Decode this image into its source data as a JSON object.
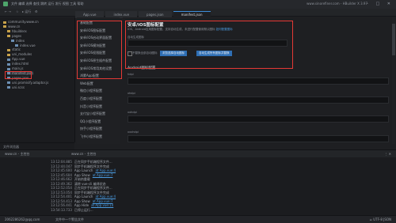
{
  "window": {
    "title": "www.sinorefiner.com - HBuilder X 3.97",
    "menu": "文件  编辑  选择  查找  跳转  运行  发行  视图  工具  帮助"
  },
  "toolbar": {
    "items": [
      "← →",
      "☆",
      "▸ 运行",
      "⚙"
    ]
  },
  "tabs": [
    {
      "label": "App.vue"
    },
    {
      "label": "index.vue"
    },
    {
      "label": "pages.json"
    },
    {
      "label": "manifest.json",
      "active": true
    }
  ],
  "tree": [
    {
      "label": "community.www.cn",
      "indent": 0
    },
    {
      "label": "www.cn",
      "indent": 0
    },
    {
      "label": "hbuilderx",
      "indent": 1
    },
    {
      "label": "pages",
      "indent": 1
    },
    {
      "label": "index",
      "indent": 2
    },
    {
      "label": "index.vue",
      "indent": 3
    },
    {
      "label": "static",
      "indent": 1
    },
    {
      "label": "uni_modules",
      "indent": 1
    },
    {
      "label": "App.vue",
      "indent": 1
    },
    {
      "label": "index.html",
      "indent": 1
    },
    {
      "label": "main.js",
      "indent": 1
    },
    {
      "label": "manifest.json",
      "indent": 1,
      "selected": true
    },
    {
      "label": "pages.json",
      "indent": 1
    },
    {
      "label": "uni.promisify.adaptor.js",
      "indent": 1
    },
    {
      "label": "uni.scss",
      "indent": 1
    }
  ],
  "explorer_footer": "文件浏览器",
  "nav": [
    "基础配置",
    "安卓/iOS图标配置",
    "安卓/iOS启动界面配置",
    "安卓/iOS模块配置",
    "安卓/iOS权限配置",
    "安卓/iOS原生插件配置",
    "安卓/iOS常用其他设置",
    "鸿蒙App配置",
    "Web配置",
    "微信小程序配置",
    "百度小程序配置",
    "抖音小程序配置",
    "支付宝小程序配置",
    "QQ小程序配置",
    "快手小程序配置",
    "飞书小程序配置"
  ],
  "content": {
    "heading": "安卓/iOS图标配置",
    "desc": "iOS、Android应用图标配置，支持自动生成，未进行配置使用默认图标",
    "desc_link": "如何配置图标",
    "source_label": "自动生成图标",
    "checkbox_label": "不替换全部自动图标",
    "btn_browse": "浏览选择自动图标",
    "btn_generate": "自动生成所有图标并替换",
    "android_title": "Android图标配置",
    "fields": [
      "hdpi",
      "xhdpi",
      "xxhdpi",
      "xxxhdpi"
    ]
  },
  "console_header": {
    "left": "www.cn - 主控台",
    "mid": "www.cn - 主控台",
    "right": "⋮ ✕"
  },
  "console": [
    {
      "time": "13:12:04.885",
      "text": "正在同步手机端程序文件...",
      "link": ""
    },
    {
      "time": "13:12:44.047",
      "text": "同步手机端程序文件完成",
      "link": ""
    },
    {
      "time": "13:12:45.600",
      "text": "App Launch",
      "link": "at App.vue:4"
    },
    {
      "time": "13:12:45.604",
      "text": "App Show",
      "link": "at App.vue:7"
    },
    {
      "time": "13:12:46.662",
      "text": "开始热重载",
      "link": ""
    },
    {
      "time": "13:12:49.362",
      "text": "清除 vue-cli 编译状态",
      "link": ""
    },
    {
      "time": "13:12:52.054",
      "text": "正在同步手机端程序文件...",
      "link": ""
    },
    {
      "time": "13:12:53.054",
      "text": "同步手机端程序文件完成",
      "link": ""
    },
    {
      "time": "13:12:54.401",
      "text": "App Launch",
      "link": "at App.vue:4"
    },
    {
      "time": "13:12:54.413",
      "text": "App Show",
      "link": "at App.vue:7"
    },
    {
      "time": "13:12:56.441",
      "text": "App Hide",
      "link": "at App.vue:10"
    },
    {
      "time": "13:54:13.733",
      "text": "已停止运行...",
      "link": ""
    }
  ],
  "status": {
    "user": "2062286262@qq.com",
    "msg": "文件中一个警告文件",
    "right": "☕  UTF-8  JSON"
  }
}
